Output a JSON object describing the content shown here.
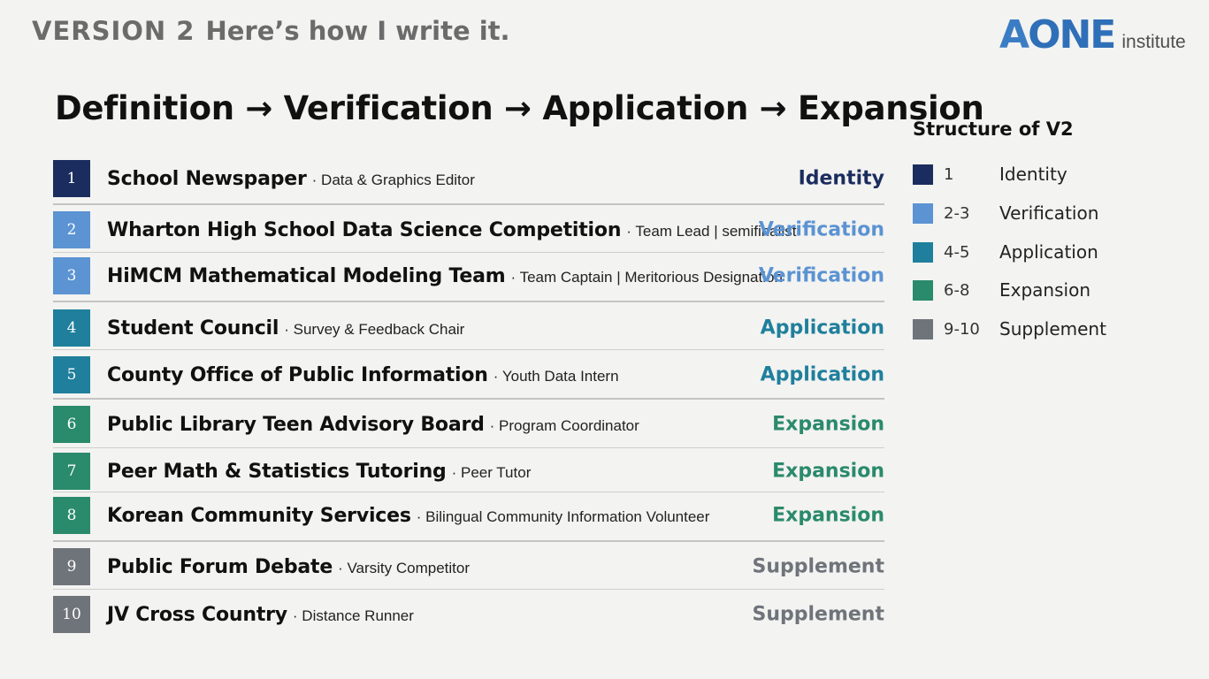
{
  "header": {
    "version_label": "VERSION 2",
    "version_subtitle": "Here’s how I write it."
  },
  "logo": {
    "mark_a": "A",
    "mark_one": "ONE",
    "text": "institute"
  },
  "title": "Definition → Verification → Application → Expansion",
  "colors": {
    "identity": "#1b2d5e",
    "verification": "#5b93d3",
    "application": "#1f7f9c",
    "expansion": "#2a8a6c",
    "supplement": "#6f737a"
  },
  "items": [
    {
      "num": "1",
      "name": "School Newspaper",
      "role": " · Data & Graphics Editor",
      "tag": "Identity"
    },
    {
      "num": "2",
      "name": "Wharton High School Data Science Competition",
      "role": "· Team Lead | semifinalist",
      "tag": "Verification"
    },
    {
      "num": "3",
      "name": "HiMCM Mathematical Modeling Team",
      "role": "· Team Captain | Meritorious Designation",
      "tag": "Verification"
    },
    {
      "num": "4",
      "name": "Student Council",
      "role": "· Survey & Feedback Chair",
      "tag": "Application"
    },
    {
      "num": "5",
      "name": "County Office of Public Information",
      "role": "· Youth Data Intern",
      "tag": "Application"
    },
    {
      "num": "6",
      "name": "Public Library Teen Advisory Board",
      "role": "· Program Coordinator",
      "tag": "Expansion"
    },
    {
      "num": "7",
      "name": "Peer Math & Statistics Tutoring",
      "role": "· Peer Tutor",
      "tag": "Expansion"
    },
    {
      "num": "8",
      "name": "Korean Community Services",
      "role": "· Bilingual Community Information Volunteer",
      "tag": "Expansion"
    },
    {
      "num": "9",
      "name": "Public Forum Debate",
      "role": "· Varsity Competitor",
      "tag": "Supplement"
    },
    {
      "num": "10",
      "name": "JV Cross Country",
      "role": "· Distance Runner",
      "tag": "Supplement"
    }
  ],
  "structure": {
    "title": "Structure of V2",
    "legend": [
      {
        "range": "1",
        "label": "Identity"
      },
      {
        "range": "2-3",
        "label": "Verification"
      },
      {
        "range": "4-5",
        "label": "Application"
      },
      {
        "range": "6-8",
        "label": "Expansion"
      },
      {
        "range": "9-10",
        "label": "Supplement"
      }
    ]
  }
}
